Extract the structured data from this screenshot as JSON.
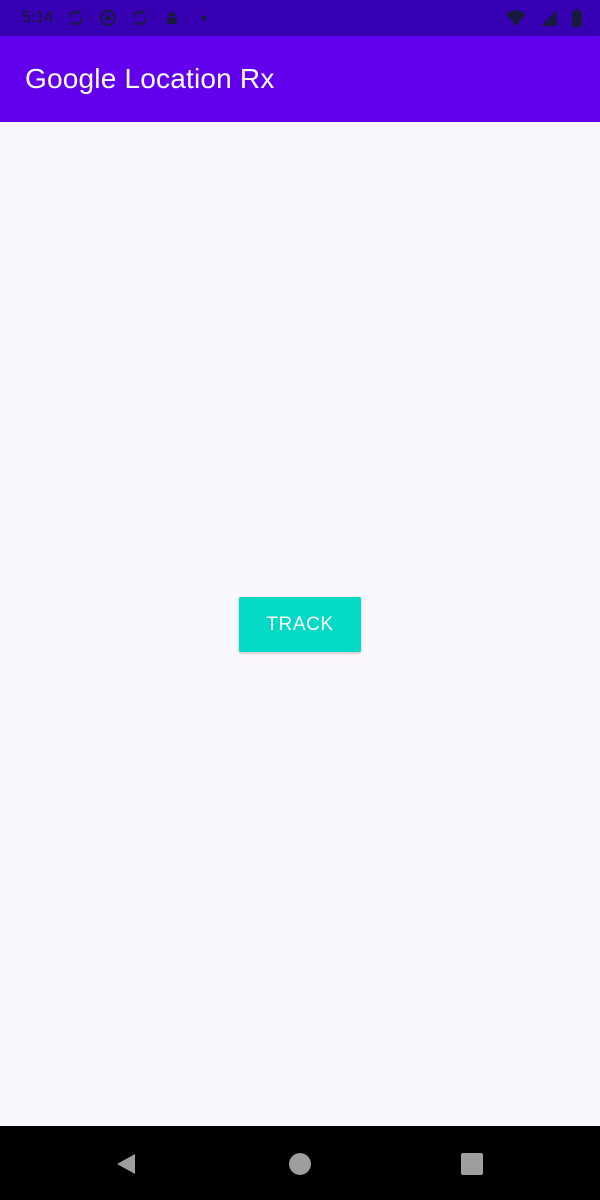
{
  "status_bar": {
    "time": "5:14",
    "notification_icons": [
      "sync-icon",
      "android-icon",
      "sync-icon",
      "android-icon",
      "dot-icon"
    ],
    "system_icons": [
      "wifi-icon",
      "signal-icon",
      "battery-icon"
    ],
    "background": "#3700b3"
  },
  "app_bar": {
    "title": "Google Location Rx",
    "background": "#6200ee"
  },
  "main": {
    "track_button_label": "TRACK",
    "button_color": "#03dac5"
  },
  "nav_bar": {
    "buttons": [
      "back-icon",
      "home-icon",
      "recents-icon"
    ]
  }
}
